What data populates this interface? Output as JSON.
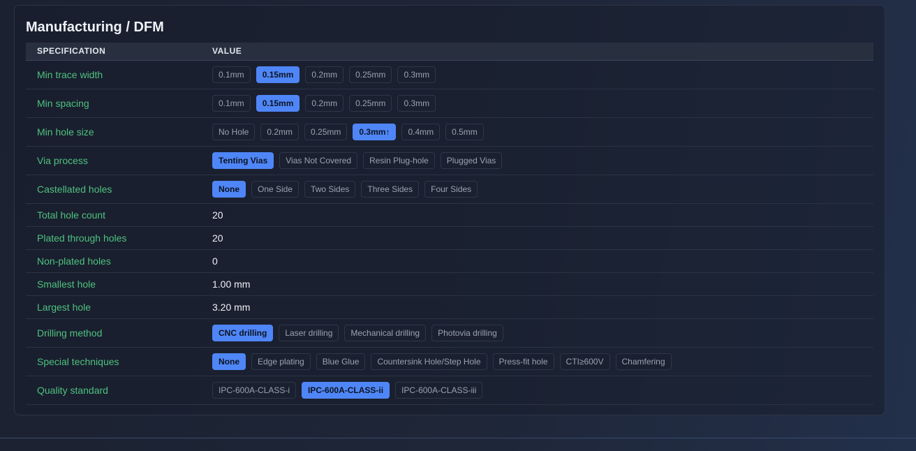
{
  "panel": {
    "title": "Manufacturing / DFM",
    "columns": {
      "spec": "SPECIFICATION",
      "value": "VALUE"
    }
  },
  "colors": {
    "accent": "#4f86f7",
    "label": "#4fc17f",
    "background": "#1b2130"
  },
  "rows": [
    {
      "label": "Min trace width",
      "options": [
        "0.1mm",
        "0.15mm",
        "0.2mm",
        "0.25mm",
        "0.3mm"
      ],
      "selected": 1
    },
    {
      "label": "Min spacing",
      "options": [
        "0.1mm",
        "0.15mm",
        "0.2mm",
        "0.25mm",
        "0.3mm"
      ],
      "selected": 1
    },
    {
      "label": "Min hole size",
      "options": [
        "No Hole",
        "0.2mm",
        "0.25mm",
        "0.3mm↑",
        "0.4mm",
        "0.5mm"
      ],
      "selected": 3
    },
    {
      "label": "Via process",
      "options": [
        "Tenting Vias",
        "Vias Not Covered",
        "Resin Plug-hole",
        "Plugged Vias"
      ],
      "selected": 0
    },
    {
      "label": "Castellated holes",
      "options": [
        "None",
        "One Side",
        "Two Sides",
        "Three Sides",
        "Four Sides"
      ],
      "selected": 0
    },
    {
      "label": "Total hole count",
      "value": "20"
    },
    {
      "label": "Plated through holes",
      "value": "20"
    },
    {
      "label": "Non-plated holes",
      "value": "0"
    },
    {
      "label": "Smallest hole",
      "value": "1.00 mm"
    },
    {
      "label": "Largest hole",
      "value": "3.20 mm"
    },
    {
      "label": "Drilling method",
      "options": [
        "CNC drilling",
        "Laser drilling",
        "Mechanical drilling",
        "Photovia drilling"
      ],
      "selected": 0
    },
    {
      "label": "Special techniques",
      "options": [
        "None",
        "Edge plating",
        "Blue Glue",
        "Countersink Hole/Step Hole",
        "Press-fit hole",
        "CTI≥600V",
        "Chamfering"
      ],
      "selected": 0
    },
    {
      "label": "Quality standard",
      "options": [
        "IPC-600A-CLASS-i",
        "IPC-600A-CLASS-ii",
        "IPC-600A-CLASS-iii"
      ],
      "selected": 1
    }
  ]
}
